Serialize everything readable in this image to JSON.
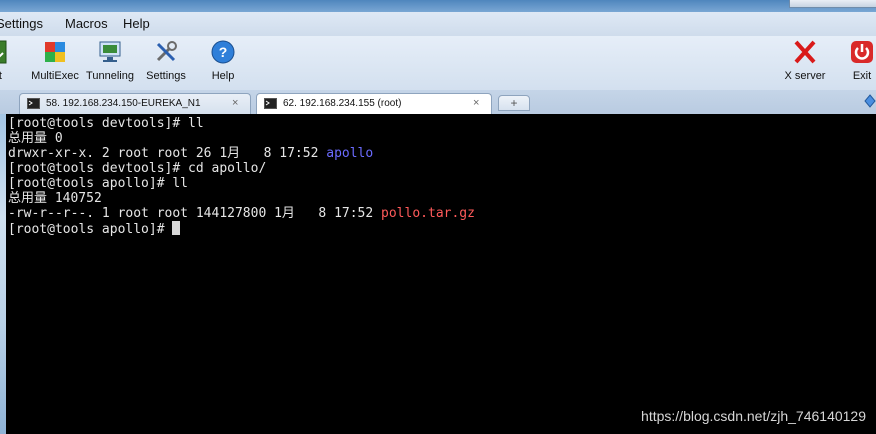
{
  "menubar": {
    "items": [
      "Settings",
      "Macros",
      "Help"
    ]
  },
  "toolbar": {
    "left_partial_label": "lit",
    "tools": [
      {
        "label": "MultiExec",
        "icon": "multiexec-icon"
      },
      {
        "label": "Tunneling",
        "icon": "tunneling-icon"
      },
      {
        "label": "Settings",
        "icon": "settings-icon"
      },
      {
        "label": "Help",
        "icon": "help-icon"
      }
    ],
    "right_tools": [
      {
        "label": "X server",
        "icon": "x-server-icon"
      },
      {
        "label": "Exit",
        "icon": "power-icon"
      }
    ]
  },
  "tabs": [
    {
      "title": "58. 192.168.234.150-EUREKA_N1",
      "close": "×",
      "active": false
    },
    {
      "title": "62. 192.168.234.155 (root)",
      "close": "×",
      "active": true
    }
  ],
  "terminal": {
    "lines": [
      {
        "text": "[root@tools devtools]# ll"
      },
      {
        "text": "总用量 0"
      },
      {
        "text": "drwxr-xr-x. 2 root root 26 1月   8 17:52 ",
        "highlight": "apollo",
        "color": "blue"
      },
      {
        "text": "[root@tools devtools]# cd apollo/"
      },
      {
        "text": "[root@tools apollo]# ll"
      },
      {
        "text": "总用量 140752"
      },
      {
        "text": "-rw-r--r--. 1 root root 144127800 1月   8 17:52 ",
        "highlight": "pollo.tar.gz",
        "color": "red"
      },
      {
        "text": "[root@tools apollo]# ",
        "cursor": true
      }
    ]
  },
  "watermark": "https://blog.csdn.net/zjh_746140129",
  "colors": {
    "terminal_bg": "#000000",
    "dir_color": "#6b6bff",
    "archive_color": "#ff5a5a"
  }
}
